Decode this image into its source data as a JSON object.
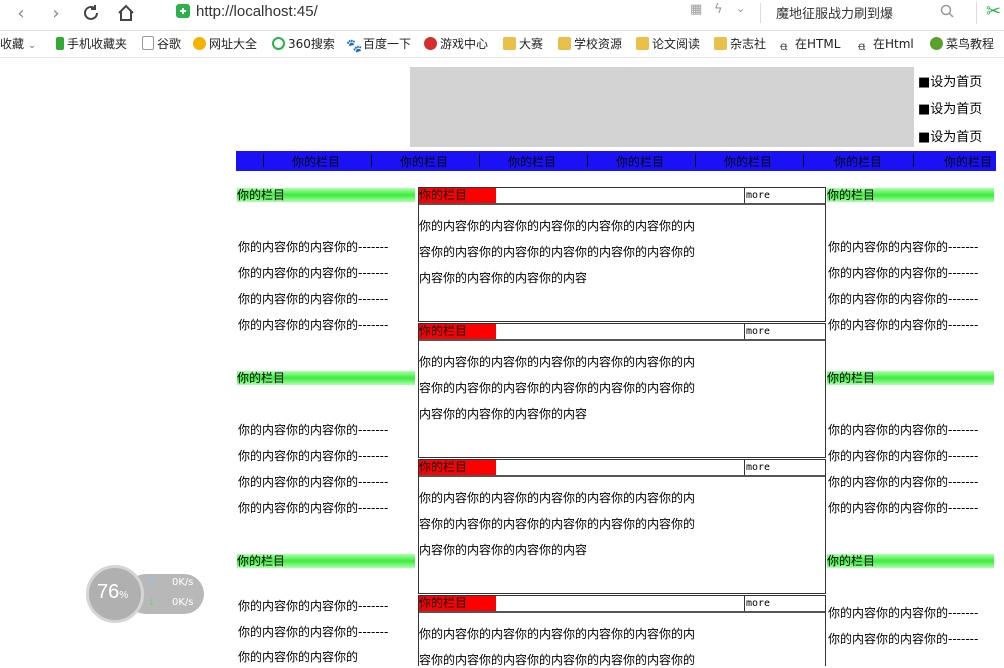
{
  "browser": {
    "url": "http://localhost:45/",
    "search_text": "魔地征服战力刷到爆"
  },
  "bookmarks": [
    {
      "label": "收藏",
      "color": "#e8a33c"
    },
    {
      "label": "手机收藏夹",
      "color": "#33aa33"
    },
    {
      "label": "谷歌",
      "color": "#999999"
    },
    {
      "label": "网址大全",
      "color": "#f3b400"
    },
    {
      "label": "360搜索",
      "color": "#2bb24c"
    },
    {
      "label": "百度一下",
      "color": "#3665d8"
    },
    {
      "label": "游戏中心",
      "color": "#d62e2e"
    },
    {
      "label": "大赛",
      "color": "#e8c04a"
    },
    {
      "label": "学校资源",
      "color": "#e8c04a"
    },
    {
      "label": "论文阅读",
      "color": "#e8c04a"
    },
    {
      "label": "杂志社",
      "color": "#e8c04a"
    },
    {
      "label": "在HTML",
      "color": "#555555"
    },
    {
      "label": "在Html",
      "color": "#555555"
    },
    {
      "label": "菜鸟教程",
      "color": "#5aa02c"
    }
  ],
  "page": {
    "home_links": [
      "■设为首页",
      "■设为首页",
      "■设为首页"
    ],
    "nav_items": [
      "你的栏目",
      "你的栏目",
      "你的栏目",
      "你的栏目",
      "你的栏目",
      "你的栏目",
      "你的栏目"
    ],
    "section_title": "你的栏目",
    "side_line": "你的内容你的内容你的-------",
    "left_partial": "你的内容你的内容你的",
    "center_title": "你的栏目",
    "more_label": "more",
    "center_lines": [
      "你的内容你的内容你的内容你的内容你的内容你的内",
      "容你的内容你的内容你的内容你的内容你的内容你的",
      "内容你的内容你的内容你的内容"
    ]
  },
  "speed_widget": {
    "percent": "76",
    "percent_unit": "%",
    "up_rate": "0K/s",
    "down_rate": "0K/s"
  }
}
